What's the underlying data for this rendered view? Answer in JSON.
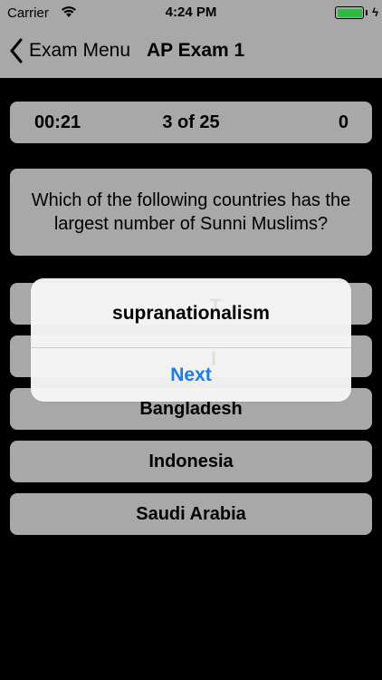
{
  "status_bar": {
    "carrier": "Carrier",
    "time": "4:24 PM",
    "battery_color": "#2fb842"
  },
  "nav": {
    "back_label": "Exam Menu",
    "back_icon": "chevron-left-icon",
    "title": "AP Exam 1"
  },
  "score_bar": {
    "timer": "00:21",
    "progress": "3 of 25",
    "score": "0"
  },
  "question": {
    "text": "Which of the following countries has the largest number of Sunni Muslims?"
  },
  "answers": [
    {
      "label": "Bangladesh"
    },
    {
      "label": "Indonesia"
    },
    {
      "label": "Saudi Arabia"
    }
  ],
  "alert": {
    "title": "supranationalism",
    "button": "Next",
    "button_color": "#1a7cf2"
  }
}
